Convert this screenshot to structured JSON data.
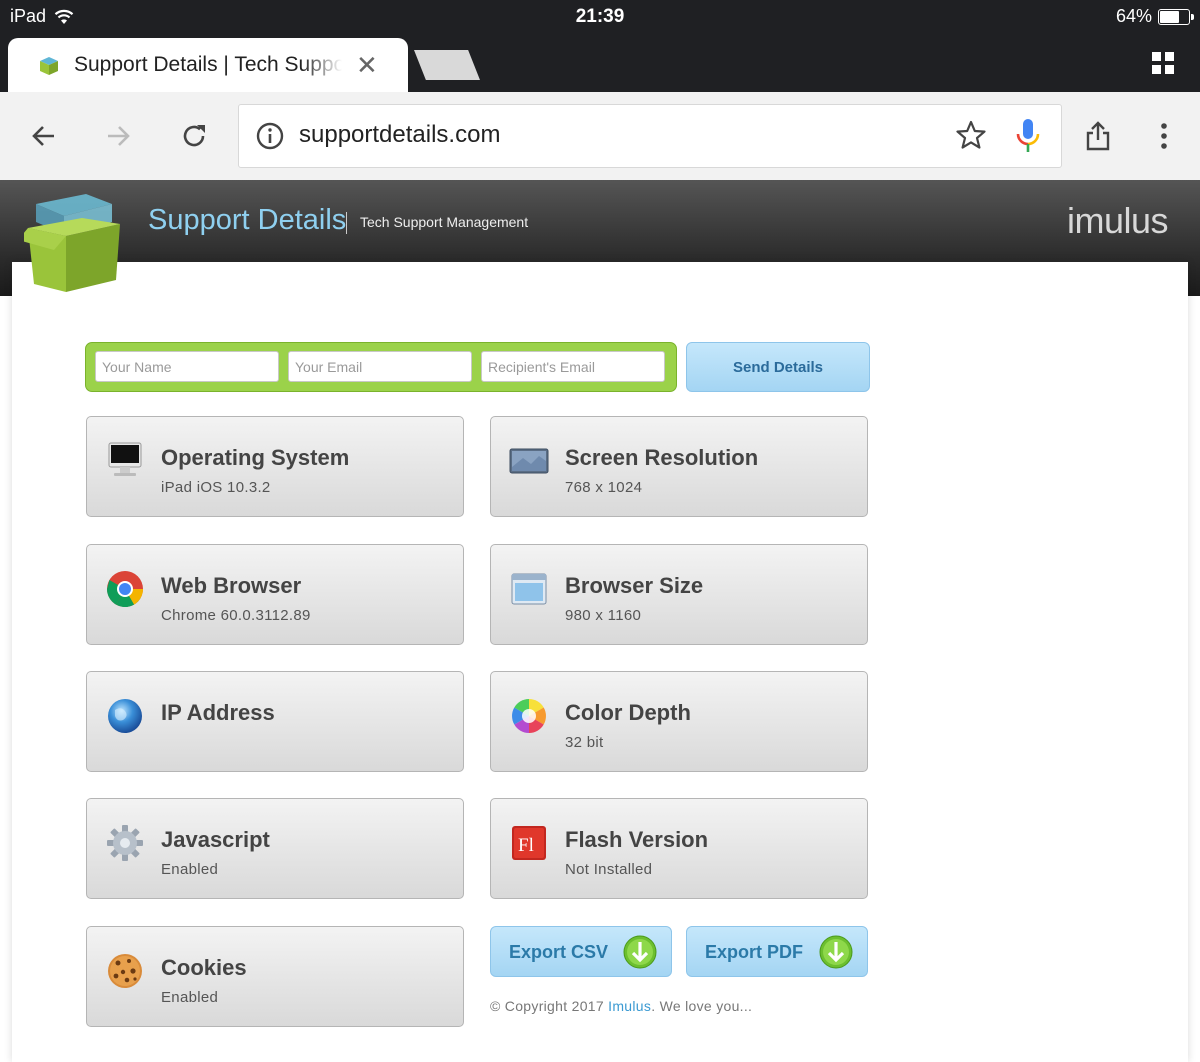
{
  "statusbar": {
    "device": "iPad",
    "time": "21:39",
    "battery": "64%",
    "battery_level": 0.64
  },
  "browser": {
    "tab_title": "Support Details | Tech Support Management",
    "url": "supportdetails.com"
  },
  "site": {
    "title": "Support Details",
    "subtitle": "Tech Support Management",
    "brand": "imulus"
  },
  "form": {
    "name_placeholder": "Your Name",
    "email_placeholder": "Your Email",
    "recipient_placeholder": "Recipient's Email",
    "send_label": "Send Details"
  },
  "cards": {
    "os": {
      "title": "Operating System",
      "value": "iPad iOS 10.3.2",
      "icon": "computer-icon"
    },
    "resolution": {
      "title": "Screen Resolution",
      "value": "768 x 1024",
      "icon": "monitor-icon"
    },
    "browser": {
      "title": "Web Browser",
      "value": "Chrome 60.0.3112.89",
      "icon": "chrome-icon"
    },
    "browser_size": {
      "title": "Browser Size",
      "value": "980 x 1160",
      "icon": "window-icon"
    },
    "ip": {
      "title": "IP Address",
      "value": "",
      "icon": "globe-icon"
    },
    "color_depth": {
      "title": "Color Depth",
      "value": "32 bit",
      "icon": "color-wheel-icon"
    },
    "javascript": {
      "title": "Javascript",
      "value": "Enabled",
      "icon": "gear-icon"
    },
    "flash": {
      "title": "Flash Version",
      "value": "Not Installed",
      "icon": "flash-icon"
    },
    "cookies": {
      "title": "Cookies",
      "value": "Enabled",
      "icon": "cookie-icon"
    }
  },
  "export": {
    "csv_label": "Export CSV",
    "pdf_label": "Export PDF"
  },
  "footer": {
    "prefix": "© Copyright 2017 ",
    "link": "Imulus",
    "suffix": ". We love you..."
  },
  "colors": {
    "accent_green": "#9bd24a",
    "accent_blue": "#a4d5f3",
    "title_blue": "#8fd0f0"
  }
}
